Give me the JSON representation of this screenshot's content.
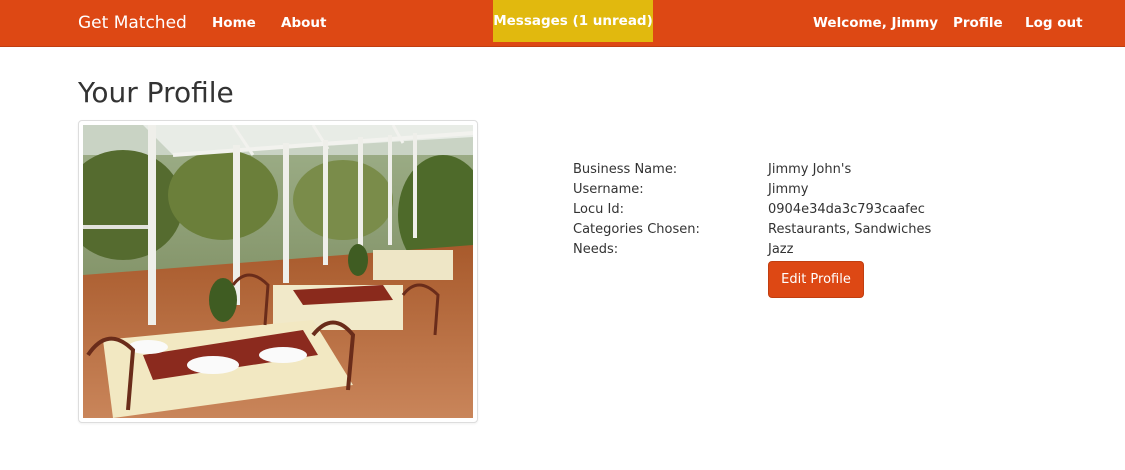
{
  "navbar": {
    "brand": "Get Matched",
    "links": [
      "Home",
      "About"
    ],
    "messages_label": "Messages (1 unread)",
    "welcome": "Welcome, Jimmy",
    "profile_label": "Profile",
    "logout_label": "Log out",
    "colors": {
      "bar": "#dd4814",
      "messages": "#e1b90e"
    }
  },
  "page": {
    "title": "Your Profile"
  },
  "profile": {
    "fields": [
      {
        "label": "Business Name:",
        "value": "Jimmy John's"
      },
      {
        "label": "Username:",
        "value": "Jimmy"
      },
      {
        "label": "Locu Id:",
        "value": "0904e34da3c793caafec"
      },
      {
        "label": "Categories Chosen:",
        "value": "Restaurants, Sandwiches"
      },
      {
        "label": "Needs:",
        "value": "Jazz"
      }
    ],
    "edit_label": "Edit Profile"
  }
}
